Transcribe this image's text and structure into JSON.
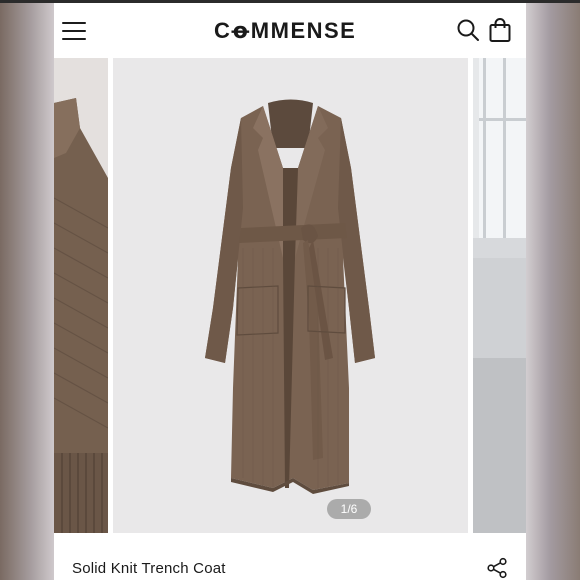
{
  "header": {
    "brand": "CꝋMMENSE",
    "menu_icon": "hamburger-menu-icon",
    "search_icon": "search-icon",
    "bag_icon": "shopping-bag-icon"
  },
  "carousel": {
    "counter": "1/6",
    "current_slide": 1,
    "total_slides": 6
  },
  "product": {
    "title": "Solid Knit Trench Coat",
    "share_icon": "share-icon"
  },
  "colors": {
    "coat": "#7a6352",
    "background": "#e9e8e9",
    "text": "#1a1a1a"
  }
}
